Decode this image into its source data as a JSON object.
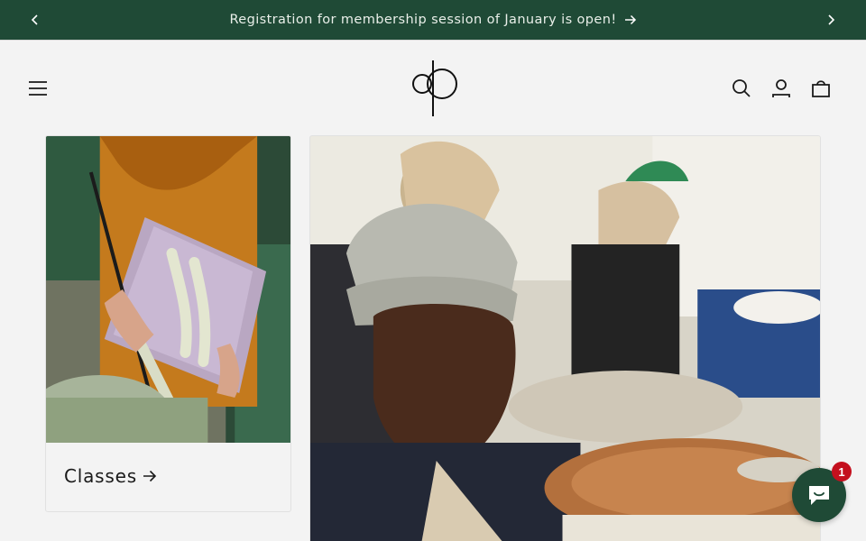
{
  "announcement": {
    "text": "Registration for membership session of January is open!",
    "prev_icon": "chevron-left-icon",
    "next_icon": "chevron-right-icon",
    "arrow_icon": "arrow-right-icon"
  },
  "header": {
    "menu_icon": "hamburger-menu-icon",
    "logo": "studio-logo",
    "search_icon": "search-icon",
    "account_icon": "account-icon",
    "cart_icon": "cart-icon"
  },
  "collections": [
    {
      "title": "Classes",
      "image": "hands glazing a ceramic tray with a brush",
      "arrow_icon": "arrow-right-icon"
    },
    {
      "title": "",
      "image": "person in beanie throwing pottery at a wheel"
    }
  ],
  "chat": {
    "badge_count": "1",
    "icon": "chat-bubble-icon"
  },
  "colors": {
    "announcement_bg": "#1f4a36",
    "page_bg": "#f3f3f3",
    "badge": "#c4101e"
  }
}
